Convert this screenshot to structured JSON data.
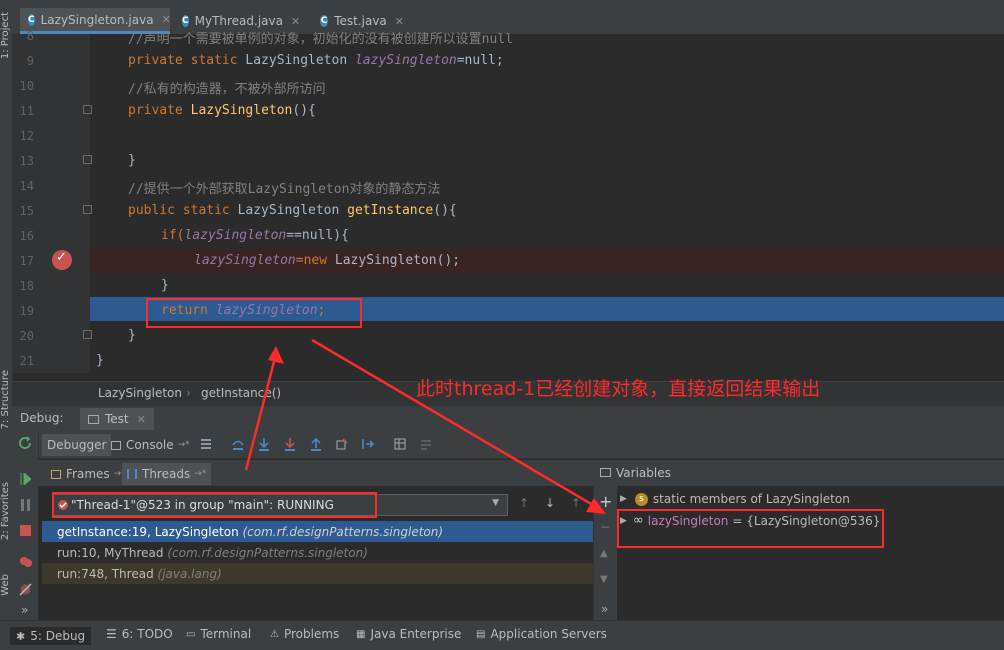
{
  "tabs": [
    {
      "label": "LazySingleton.java"
    },
    {
      "label": "MyThread.java"
    },
    {
      "label": "Test.java"
    }
  ],
  "left_stripe": {
    "project": "1: Project",
    "structure": "7: Structure",
    "favorites": "2: Favorites",
    "web": "Web"
  },
  "code": {
    "lines": [
      {
        "num": "8",
        "text": "//声明一个需要被单例的对象，初始化的没有被创建所以设置null"
      },
      {
        "num": "9",
        "p1": "private static ",
        "p2": "LazySingleton ",
        "p3": "lazySingleton",
        "p4": "=null;"
      },
      {
        "num": "10",
        "text": "//私有的构造器，不被外部所访问"
      },
      {
        "num": "11",
        "p1": "private ",
        "p2": "LazySingleton",
        "p3": "(){"
      },
      {
        "num": "12",
        "text": ""
      },
      {
        "num": "13",
        "text": "}"
      },
      {
        "num": "14",
        "text": "//提供一个外部获取LazySingleton对象的静态方法"
      },
      {
        "num": "15",
        "p1": "public static ",
        "p2": "LazySingleton ",
        "p3": "getInstance",
        "p4": "(){"
      },
      {
        "num": "16",
        "p1": "if(",
        "p2": "lazySingleton",
        "p3": "==null){"
      },
      {
        "num": "17",
        "p1": "lazySingleton",
        "p2": "=new ",
        "p3": "LazySingleton();"
      },
      {
        "num": "18",
        "text": "}"
      },
      {
        "num": "19",
        "p1": "return ",
        "p2": "lazySingleton",
        ";": ";"
      },
      {
        "num": "20",
        "text": "}"
      },
      {
        "num": "21",
        "text": "}"
      }
    ]
  },
  "breadcrumb": {
    "class": "LazySingleton",
    "method": "getInstance()"
  },
  "debug": {
    "title": "Debug:",
    "run_tab": "Test",
    "debugger_tab": "Debugger",
    "console_tab": "Console",
    "console_suffix": "→*",
    "frames_tab": "Frames",
    "threads_tab": "Threads",
    "thread_selected": "\"Thread-1\"@523 in group \"main\": RUNNING",
    "frames": [
      {
        "method": "getInstance:19, LazySingleton",
        "pkg": "(com.rf.designPatterns.singleton)"
      },
      {
        "method": "run:10, MyThread",
        "pkg": "(com.rf.designPatterns.singleton)"
      },
      {
        "method": "run:748, Thread",
        "pkg": "(java.lang)"
      }
    ],
    "variables_title": "Variables",
    "variables": [
      {
        "name": "static members of LazySingleton",
        "value": ""
      },
      {
        "name": "lazySingleton",
        "value": "= {LazySingleton@536}"
      }
    ]
  },
  "annotation": "此时thread-1已经创建对象，直接返回结果输出",
  "bottom": [
    {
      "label": "5: Debug"
    },
    {
      "label": "6: TODO"
    },
    {
      "label": "Terminal"
    },
    {
      "label": "Problems"
    },
    {
      "label": "Java Enterprise"
    },
    {
      "label": "Application Servers"
    }
  ]
}
